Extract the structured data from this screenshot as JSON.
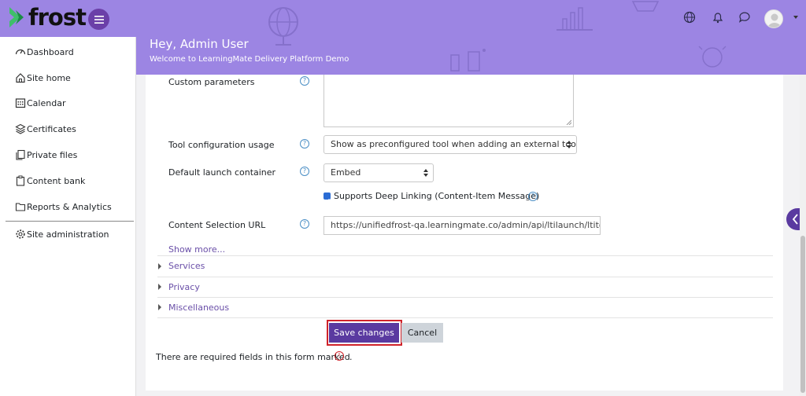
{
  "brand": {
    "name": "frost"
  },
  "header": {
    "greeting": "Hey, Admin User",
    "subtitle": "Welcome to LearningMate Delivery Platform Demo",
    "icons": [
      "globe-icon",
      "bell-icon",
      "chat-icon",
      "avatar"
    ]
  },
  "sidebar": {
    "items": [
      {
        "label": "Dashboard",
        "icon": "gauge-icon"
      },
      {
        "label": "Site home",
        "icon": "home-icon"
      },
      {
        "label": "Calendar",
        "icon": "calendar-icon"
      },
      {
        "label": "Certificates",
        "icon": "layers-icon"
      },
      {
        "label": "Private files",
        "icon": "files-icon"
      },
      {
        "label": "Content bank",
        "icon": "clipboard-icon"
      },
      {
        "label": "Reports & Analytics",
        "icon": "folder-icon"
      },
      {
        "label": "Site administration",
        "icon": "gear-icon"
      }
    ]
  },
  "form": {
    "custom_params_label": "Custom parameters",
    "tool_config_label": "Tool configuration usage",
    "tool_config_value": "Show as preconfigured tool when adding an external tool",
    "launch_container_label": "Default launch container",
    "launch_container_value": "Embed",
    "deep_linking_label": "Supports Deep Linking (Content-Item Message)",
    "content_url_label": "Content Selection URL",
    "content_url_value": "https://unifiedfrost-qa.learningmate.co/admin/api/ltilaunch/ltitoo",
    "show_more": "Show more...",
    "sections": [
      "Services",
      "Privacy",
      "Miscellaneous"
    ],
    "save_label": "Save changes",
    "cancel_label": "Cancel",
    "required_note": "There are required fields in this form marked",
    "required_dot": "."
  },
  "colors": {
    "header_bg": "#9c85e3",
    "accent": "#5a3aa0",
    "highlight_outline": "#d0232a"
  }
}
